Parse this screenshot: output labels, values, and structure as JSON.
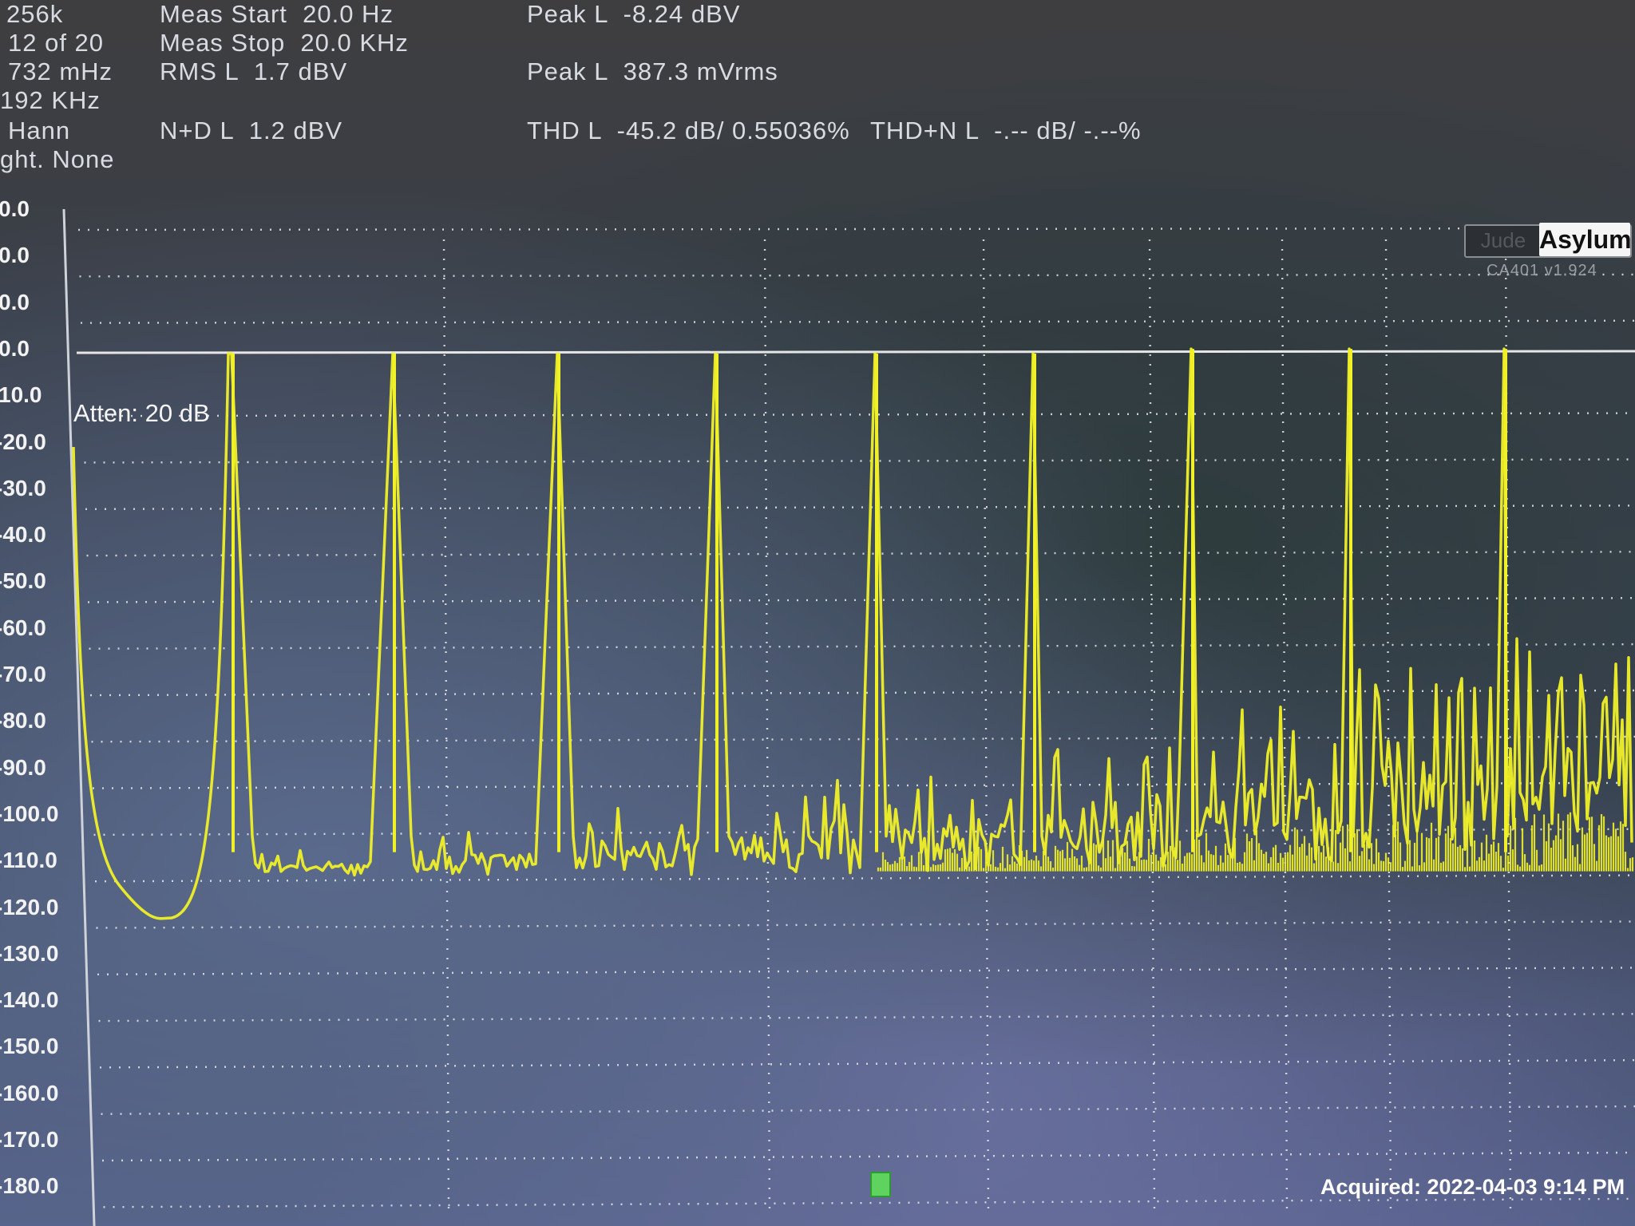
{
  "header": {
    "col1": [
      "256k",
      "12 of 20",
      "732 mHz",
      "192 KHz",
      "Hann",
      "ght. None"
    ],
    "col2": [
      "Meas Start  20.0 Hz",
      "Meas Stop  20.0 KHz",
      "RMS L  1.7 dBV",
      "N+D L  1.2 dBV"
    ],
    "col3": [
      "Peak L  -8.24 dBV",
      "Peak L  387.3 mVrms",
      "THD L  -45.2 dB/ 0.55036%"
    ],
    "col4": [
      "THD+N L  -.-- dB/ -.--%"
    ]
  },
  "plot": {
    "atten_label": "Atten: 20 dB",
    "y_tick_labels": [
      "0.0",
      "0.0",
      "0.0",
      "0.0",
      "10.0",
      "-20.0",
      "-30.0",
      "-40.0",
      "-50.0",
      "-60.0",
      "-70.0",
      "-80.0",
      "-90.0",
      "-100.0",
      "-110.0",
      "-120.0",
      "-130.0",
      "-140.0",
      "-150.0",
      "-160.0",
      "-170.0",
      "-180.0"
    ],
    "trace_color": "#f0f028",
    "grid_color": "#e8e8e8"
  },
  "logo": {
    "brand": "Asylum",
    "faint": "Jude",
    "sub": "CA401 v1.924"
  },
  "acquired": "Acquired: 2022-04-03  9:14 PM",
  "chart_data": {
    "type": "line",
    "ylabel": "",
    "xlabel": "",
    "y_ticks": [
      -10,
      -20,
      -30,
      -40,
      -50,
      -60,
      -70,
      -80,
      -90,
      -100,
      -110,
      -120,
      -130,
      -140,
      -150,
      -160,
      -170,
      -180
    ],
    "ylim": [
      -180,
      0
    ],
    "grid": true,
    "harmonic_peaks": [
      {
        "harmonic": 1,
        "value": -10
      },
      {
        "harmonic": 2,
        "value": -10
      },
      {
        "harmonic": 3,
        "value": -10
      },
      {
        "harmonic": 4,
        "value": -10
      },
      {
        "harmonic": 5,
        "value": -10
      },
      {
        "harmonic": 6,
        "value": -10
      },
      {
        "harmonic": 7,
        "value": -9
      },
      {
        "harmonic": 8,
        "value": -9
      },
      {
        "harmonic": 9,
        "value": -9
      }
    ],
    "noise_floor": -120
  }
}
